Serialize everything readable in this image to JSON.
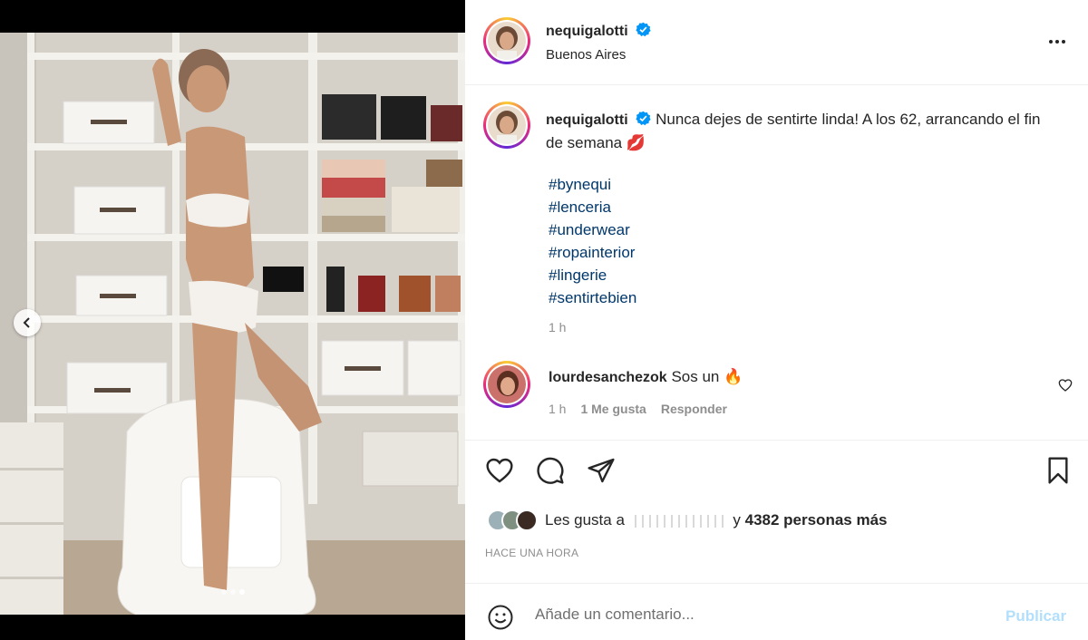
{
  "post": {
    "username": "nequigalotti",
    "verified": true,
    "location": "Buenos Aires",
    "more_icon": "more-horizontal-icon"
  },
  "caption": {
    "username": "nequigalotti",
    "text": "Nunca dejes de sentirte linda! A los 62, arrancando el fin de semana",
    "emoji": "💋",
    "hashtags": [
      "#bynequi",
      "#lenceria",
      "#underwear",
      "#ropainterior",
      "#lingerie",
      "#sentirtebien"
    ],
    "time": "1 h"
  },
  "comment": {
    "username": "lourdesanchezok",
    "text": "Sos un",
    "emoji": "🔥",
    "time": "1 h",
    "likes": "1 Me gusta",
    "reply": "Responder"
  },
  "actions": {
    "like_icon": "heart-icon",
    "comment_icon": "comment-icon",
    "share_icon": "send-icon",
    "save_icon": "bookmark-icon"
  },
  "likes": {
    "prefix": "Les gusta a",
    "connector": "y",
    "count_text": "4382 personas más"
  },
  "posted_ago": "HACE UNA HORA",
  "composer": {
    "placeholder": "Añade un comentario...",
    "publish": "Publicar"
  },
  "carousel": {
    "total": 3,
    "active_index": 2
  },
  "colors": {
    "link": "#00376b",
    "verified": "#0095f6",
    "publish_disabled": "#b2dffc",
    "muted": "#8e8e8e"
  }
}
